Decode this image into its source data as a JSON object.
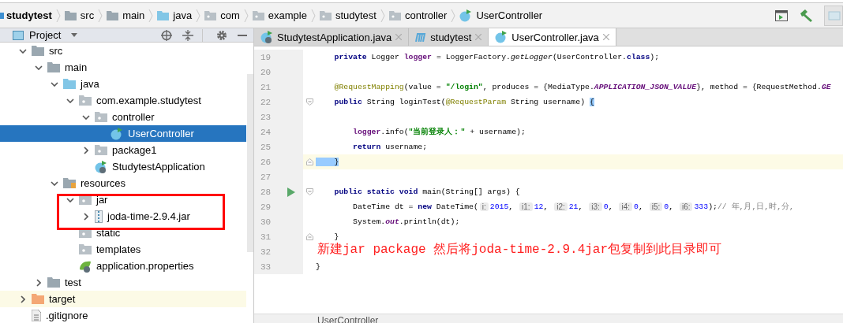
{
  "breadcrumb": {
    "items": [
      {
        "label": "studytest",
        "kind": "module"
      },
      {
        "label": "src",
        "kind": "folder"
      },
      {
        "label": "main",
        "kind": "folder"
      },
      {
        "label": "java",
        "kind": "source-folder"
      },
      {
        "label": "com",
        "kind": "package"
      },
      {
        "label": "example",
        "kind": "package"
      },
      {
        "label": "studytest",
        "kind": "package"
      },
      {
        "label": "controller",
        "kind": "package"
      },
      {
        "label": "UserController",
        "kind": "class"
      }
    ]
  },
  "project_panel": {
    "title": "Project",
    "tree": [
      {
        "label": "src",
        "kind": "folder",
        "expanded": true,
        "children": [
          {
            "label": "main",
            "kind": "folder",
            "expanded": true,
            "children": [
              {
                "label": "java",
                "kind": "source-folder",
                "expanded": true,
                "children": [
                  {
                    "label": "com.example.studytest",
                    "kind": "package",
                    "expanded": true,
                    "children": [
                      {
                        "label": "controller",
                        "kind": "package",
                        "expanded": true,
                        "children": [
                          {
                            "label": "UserController",
                            "kind": "class",
                            "selected": true
                          }
                        ]
                      },
                      {
                        "label": "package1",
                        "kind": "package",
                        "expanded": false
                      },
                      {
                        "label": "StudytestApplication",
                        "kind": "spring-class",
                        "selected": false
                      }
                    ]
                  }
                ]
              },
              {
                "label": "resources",
                "kind": "resources-folder",
                "expanded": true,
                "children": [
                  {
                    "label": "jar",
                    "kind": "package",
                    "expanded": true,
                    "children": [
                      {
                        "label": "joda-time-2.9.4.jar",
                        "kind": "jar",
                        "expanded": false
                      }
                    ]
                  },
                  {
                    "label": "static",
                    "kind": "package"
                  },
                  {
                    "label": "templates",
                    "kind": "package"
                  },
                  {
                    "label": "application.properties",
                    "kind": "spring-properties",
                    "selected": false
                  }
                ]
              }
            ]
          },
          {
            "label": "test",
            "kind": "folder",
            "expanded": false
          }
        ]
      },
      {
        "label": "target",
        "kind": "excluded-folder",
        "expanded": false
      },
      {
        "label": ".gitignore",
        "kind": "file",
        "selected": false
      }
    ]
  },
  "tabs": [
    {
      "label": "StudytestApplication.java",
      "kind": "spring-class",
      "selected": false
    },
    {
      "label": "studytest",
      "kind": "maven",
      "selected": false
    },
    {
      "label": "UserController.java",
      "kind": "class",
      "selected": true
    }
  ],
  "code": [
    {
      "number": "19",
      "tokens": [
        {
          "kind": "keyword",
          "text": "    private"
        },
        {
          "kind": "plain",
          "text": " Logger "
        },
        {
          "kind": "field",
          "text": "logger"
        },
        {
          "kind": "plain",
          "text": " = LoggerFactory."
        },
        {
          "kind": "static-method",
          "text": "getLogger"
        },
        {
          "kind": "plain",
          "text": "(UserController."
        },
        {
          "kind": "keyword",
          "text": "class"
        },
        {
          "kind": "plain",
          "text": ");"
        }
      ]
    },
    {
      "number": "20"
    },
    {
      "number": "21",
      "tokens": [
        {
          "kind": "annotation",
          "text": "    @RequestMapping"
        },
        {
          "kind": "plain",
          "text": "(value = "
        },
        {
          "kind": "string",
          "text": "\"/login\""
        },
        {
          "kind": "plain",
          "text": ", produces = {MediaType."
        },
        {
          "kind": "constant",
          "text": "APPLICATION_JSON_VALUE"
        },
        {
          "kind": "plain",
          "text": "}, method = {RequestMethod."
        },
        {
          "kind": "constant",
          "text": "GE"
        }
      ]
    },
    {
      "number": "22",
      "fold_open": true,
      "tokens": [
        {
          "kind": "keyword",
          "text": "    public"
        },
        {
          "kind": "plain",
          "text": " String loginTest("
        },
        {
          "kind": "annotation",
          "text": "@RequestParam"
        },
        {
          "kind": "plain",
          "text": " String username) "
        },
        {
          "kind": "brace-match",
          "text": "{"
        }
      ]
    },
    {
      "number": "23"
    },
    {
      "number": "24",
      "tokens": [
        {
          "kind": "field",
          "text": "        logger"
        },
        {
          "kind": "plain",
          "text": ".info("
        },
        {
          "kind": "string",
          "text": "\"当前登录人：\""
        },
        {
          "kind": "plain",
          "text": " + username);"
        }
      ]
    },
    {
      "number": "25",
      "tokens": [
        {
          "kind": "keyword",
          "text": "        return"
        },
        {
          "kind": "plain",
          "text": " username;"
        }
      ]
    },
    {
      "number": "26",
      "fold_close": true,
      "current": true,
      "tokens": [
        {
          "kind": "brace-match",
          "text": "    }"
        }
      ]
    },
    {
      "number": "27"
    },
    {
      "number": "28",
      "fold_open": true,
      "run": true,
      "tokens": [
        {
          "kind": "keyword",
          "text": "    public static void"
        },
        {
          "kind": "plain",
          "text": " main(String[] args) {"
        }
      ]
    },
    {
      "number": "29",
      "tokens": [
        {
          "kind": "plain",
          "text": "        DateTime dt = "
        },
        {
          "kind": "keyword",
          "text": "new"
        },
        {
          "kind": "plain",
          "text": " DateTime("
        },
        {
          "kind": "hint",
          "text": "i:"
        },
        {
          "kind": "number",
          "text": "2015"
        },
        {
          "kind": "plain",
          "text": ", "
        },
        {
          "kind": "hint",
          "text": "i1:"
        },
        {
          "kind": "number",
          "text": "12"
        },
        {
          "kind": "plain",
          "text": ", "
        },
        {
          "kind": "hint",
          "text": "i2:"
        },
        {
          "kind": "number",
          "text": "21"
        },
        {
          "kind": "plain",
          "text": ", "
        },
        {
          "kind": "hint",
          "text": "i3:"
        },
        {
          "kind": "number",
          "text": "0"
        },
        {
          "kind": "plain",
          "text": ", "
        },
        {
          "kind": "hint",
          "text": "i4:"
        },
        {
          "kind": "number",
          "text": "0"
        },
        {
          "kind": "plain",
          "text": ", "
        },
        {
          "kind": "hint",
          "text": "i5:"
        },
        {
          "kind": "number",
          "text": "0"
        },
        {
          "kind": "plain",
          "text": ", "
        },
        {
          "kind": "hint",
          "text": "i6:"
        },
        {
          "kind": "number",
          "text": "333"
        },
        {
          "kind": "plain",
          "text": ");"
        },
        {
          "kind": "comment",
          "text": "// 年,月,日,时,分,"
        }
      ]
    },
    {
      "number": "30",
      "tokens": [
        {
          "kind": "plain",
          "text": "        System."
        },
        {
          "kind": "static-field",
          "text": "out"
        },
        {
          "kind": "plain",
          "text": ".println(dt);"
        }
      ]
    },
    {
      "number": "31",
      "fold_close": true,
      "tokens": [
        {
          "kind": "plain",
          "text": "    }"
        }
      ]
    },
    {
      "number": "32"
    },
    {
      "number": "33",
      "tokens": [
        {
          "kind": "plain",
          "text": "}"
        }
      ]
    }
  ],
  "editor_breadcrumb": "UserController",
  "annotation": {
    "text": "新建jar package 然后将joda-time-2.9.4jar包复制到此目录即可"
  }
}
